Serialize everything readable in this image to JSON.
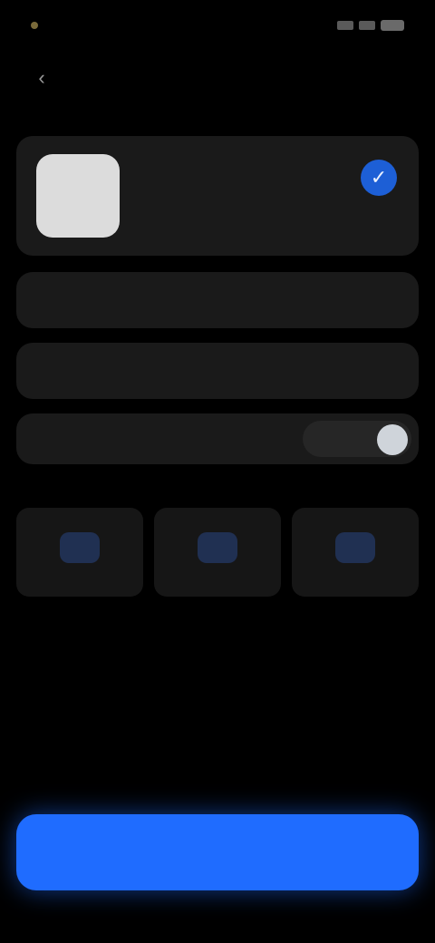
{
  "status_bar": {
    "time": "",
    "icons": [
      "signal-icon",
      "wifi-icon",
      "battery-icon"
    ]
  },
  "header": {
    "title": "",
    "back_icon": "chevron-left-icon"
  },
  "profile": {
    "name": "",
    "subtitle": "",
    "selected_icon": "checkmark-icon"
  },
  "option_row_1": {
    "left": "",
    "right": ""
  },
  "option_row_2": {
    "left": "",
    "right": ""
  },
  "toggle_row": {
    "label": "",
    "on": true
  },
  "section": {
    "label": ""
  },
  "tiles": [
    {
      "label": "",
      "icon": "tile-1-icon"
    },
    {
      "label": "",
      "icon": "tile-2-icon"
    },
    {
      "label": "",
      "icon": "tile-3-icon"
    }
  ],
  "primary_button": {
    "label": ""
  },
  "colors": {
    "background": "#000000",
    "card": "#1a1a1a",
    "accent": "#1f6cff",
    "check": "#1d5fd6"
  }
}
